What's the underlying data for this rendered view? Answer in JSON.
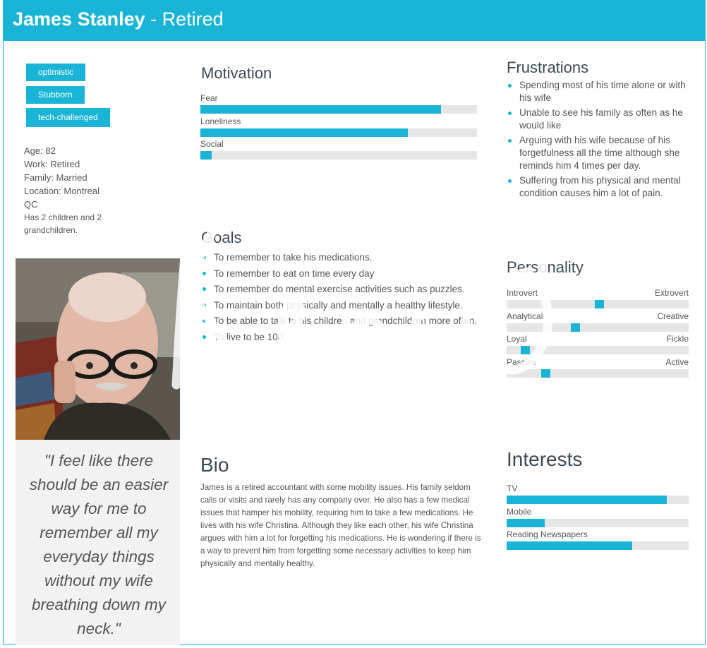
{
  "header": {
    "name": "James Stanley",
    "role": " - Retired"
  },
  "tags": [
    "optimistic",
    "Stubborn",
    "tech-challenged"
  ],
  "facts": {
    "age": "Age: 82",
    "work": "Work: Retired",
    "family": "Family: Married",
    "location_1": "Location: Montreal",
    "location_2": "QC",
    "children_1": "Has 2 children and 2",
    "children_2": "grandchildren."
  },
  "quote": "\"I feel like there should be an easier way for me to remember all my everyday things without my wife breathing down my neck.\"",
  "motivation": {
    "title": "Motivation",
    "bars": [
      {
        "label": "Fear",
        "value": 0.87
      },
      {
        "label": "Loneliness",
        "value": 0.75
      },
      {
        "label": "Social",
        "value": 0.04
      }
    ]
  },
  "frustrations": {
    "title": "Frustrations",
    "items": [
      "Spending most of his time alone or with his wife",
      " Unable to see his family as often as he would like",
      "Arguing with his wife because of his forgetfulness all the time although she reminds him 4 times per day.",
      "Suffering from his physical and mental condition causes him a lot of pain."
    ]
  },
  "goals": {
    "title": "Goals",
    "items": [
      "To remember to take his medications.",
      "To remember to eat on time every day",
      "To remember do mental exercise activities such as puzzles.",
      "To maintain both physically and mentally a healthy lifestyle.",
      "To be able to talk to his children and grandchildren more often.",
      "To live to be 100."
    ]
  },
  "personality": {
    "title": "Personality",
    "traits": [
      {
        "left": "Introvert",
        "right": "Extrovert",
        "value": 0.51
      },
      {
        "left": "Analytical",
        "right": "Creative",
        "value": 0.37
      },
      {
        "left": "Loyal",
        "right": "Fickle",
        "value": 0.08
      },
      {
        "left": "Passive",
        "right": "Active",
        "value": 0.2
      }
    ]
  },
  "bio": {
    "title": "Bio",
    "text": "James is a retired accountant with some mobility issues. His family seldom calls or visits and rarely has any company over. He also has a few medical issues that hamper his mobility, requiring him to take a few medications. He lives with his wife Christina. Although they like each other, his wife Christina argues with him a lot for forgetting his medications. He is wondering if there is a way to prevent him from forgetting some necessary activities to keep him physically and mentally healthy."
  },
  "interests": {
    "title": "Interests",
    "bars": [
      {
        "label": "TV",
        "value": 0.88
      },
      {
        "label": "Mobile",
        "value": 0.21
      },
      {
        "label": "Reading Newspapers",
        "value": 0.69
      }
    ]
  },
  "colors": {
    "accent": "#1ab5d6",
    "track": "#e6e6e7",
    "heading": "#3d4a55"
  }
}
